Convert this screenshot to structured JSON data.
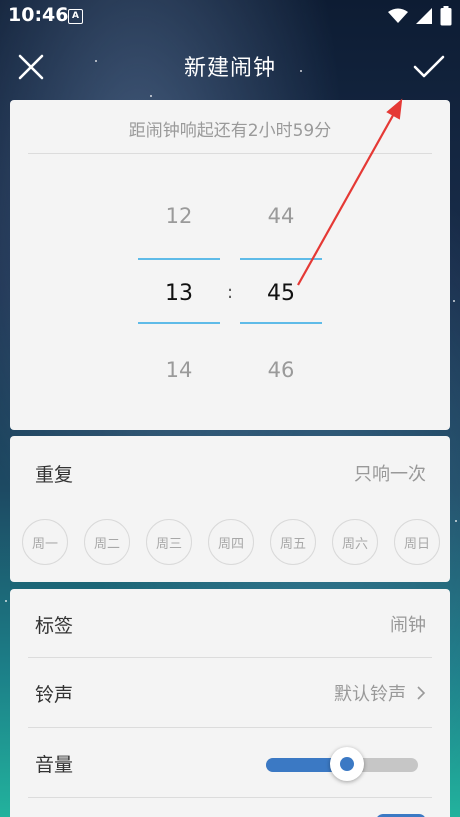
{
  "status_bar": {
    "time": "10:46",
    "indicator": "A",
    "icons": [
      "wifi-icon",
      "signal-icon",
      "battery-icon"
    ]
  },
  "header": {
    "title": "新建闹钟",
    "close_icon": "close-icon",
    "confirm_icon": "check-icon"
  },
  "picker": {
    "countdown_text": "距闹钟响起还有2小时59分",
    "hour": {
      "prev": "12",
      "current": "13",
      "next": "14"
    },
    "minute": {
      "prev": "44",
      "current": "45",
      "next": "46"
    },
    "separator": ":"
  },
  "repeat": {
    "label": "重复",
    "value": "只响一次",
    "days": [
      "周一",
      "周二",
      "周三",
      "周四",
      "周五",
      "周六",
      "周日"
    ]
  },
  "settings": {
    "tag": {
      "label": "标签",
      "value": "闹钟"
    },
    "ringtone": {
      "label": "铃声",
      "value": "默认铃声"
    },
    "volume": {
      "label": "音量",
      "level": 0.53
    }
  },
  "colors": {
    "accent": "#3b79c4",
    "picker_line": "#5fbbe8",
    "annotation": "#e53935",
    "card_bg": "#f4f4f4"
  }
}
